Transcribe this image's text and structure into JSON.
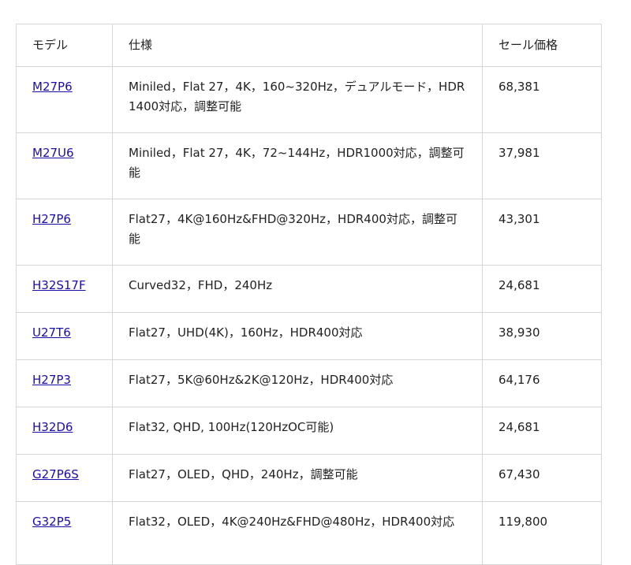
{
  "table": {
    "headers": [
      "モデル",
      "仕様",
      "セール価格"
    ],
    "rows": [
      {
        "model": "M27P6",
        "spec": "Miniled，Flat 27，4K，160~320Hz，デュアルモード，HDR1400対応，調整可能",
        "price": "68,381",
        "lines": 2
      },
      {
        "model": "M27U6",
        "spec": "Miniled，Flat 27，4K，72~144Hz，HDR1000対応，調整可能",
        "price": "37,981",
        "lines": 2
      },
      {
        "model": "H27P6",
        "spec": "Flat27，4K@160Hz&FHD@320Hz，HDR400対応，調整可能",
        "price": "43,301",
        "lines": 2
      },
      {
        "model": "H32S17F",
        "spec": "Curved32，FHD，240Hz",
        "price": "24,681",
        "lines": 1
      },
      {
        "model": "U27T6",
        "spec": "Flat27，UHD(4K)，160Hz，HDR400対応",
        "price": "38,930",
        "lines": 1
      },
      {
        "model": "H27P3",
        "spec": "Flat27，5K@60Hz&2K@120Hz，HDR400対応",
        "price": "64,176",
        "lines": 1
      },
      {
        "model": "H32D6",
        "spec": "Flat32, QHD, 100Hz(120HzOC可能)",
        "price": "24,681",
        "lines": 1
      },
      {
        "model": "G27P6S",
        "spec": "Flat27，OLED，QHD，240Hz，調整可能",
        "price": "67,430",
        "lines": 1
      },
      {
        "model": "G32P5",
        "spec": "Flat32，OLED，4K@240Hz&FHD@480Hz，HDR400対応",
        "price": "119,800",
        "lines": 2
      }
    ]
  }
}
